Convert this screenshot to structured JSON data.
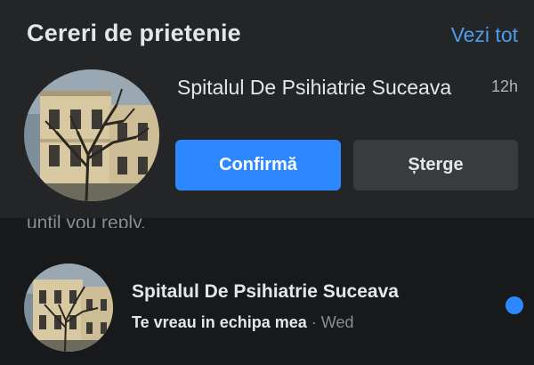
{
  "friend_requests": {
    "title": "Cereri de prietenie",
    "see_all_label": "Vezi tot",
    "request": {
      "name": "Spitalul De Psihiatrie Suceava",
      "time": "12h",
      "confirm_label": "Confirmă",
      "delete_label": "Șterge"
    }
  },
  "partial_text": "until you reply.",
  "message": {
    "sender": "Spitalul De Psihiatrie Suceava",
    "preview": "Te vreau in echipa mea",
    "separator": "·",
    "time": "Wed",
    "unread": true
  },
  "colors": {
    "background": "#18191a",
    "card": "#242526",
    "accent": "#2d88ff",
    "link": "#4b9dec",
    "secondary_button": "#3a3b3c"
  }
}
